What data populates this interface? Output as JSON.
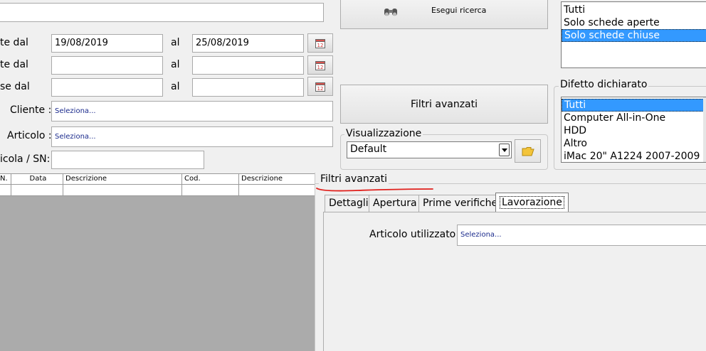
{
  "filters": {
    "top_input_value": "",
    "row1": {
      "label": "te dal",
      "from": "19/08/2019",
      "to_label": "al",
      "to": "25/08/2019"
    },
    "row2": {
      "label": "te dal",
      "from": "",
      "to_label": "al",
      "to": ""
    },
    "row3": {
      "label": "se dal",
      "from": "",
      "to_label": "al",
      "to": ""
    },
    "cliente": {
      "label": "Cliente :",
      "value": "Seleziona..."
    },
    "articolo": {
      "label": "Articolo :",
      "value": "Seleziona..."
    },
    "matricola": {
      "label": "icola / SN:",
      "value": ""
    }
  },
  "search_button": {
    "label": "Esegui ricerca"
  },
  "status_list": {
    "items": [
      {
        "label": "Tutti",
        "selected": false
      },
      {
        "label": "Solo schede aperte",
        "selected": false
      },
      {
        "label": "Solo schede chiuse",
        "selected": true
      }
    ]
  },
  "advanced_button": {
    "label": "Filtri avanzati"
  },
  "visualizzazione": {
    "title": "Visualizzazione",
    "selected": "Default"
  },
  "difetto": {
    "title": "Difetto dichiarato",
    "items": [
      {
        "label": "Tutti",
        "selected": true
      },
      {
        "label": "Computer All-in-One",
        "selected": false
      },
      {
        "label": "HDD",
        "selected": false
      },
      {
        "label": "Altro",
        "selected": false
      },
      {
        "label": "iMac 20\" A1224 2007-2009",
        "selected": false
      }
    ]
  },
  "grid": {
    "columns": [
      "N.",
      "Data",
      "Descrizione",
      "Cod.",
      "Descrizione"
    ]
  },
  "advanced_panel": {
    "title": "Filtri avanzati",
    "tabs": [
      {
        "label": "Dettagli",
        "active": false
      },
      {
        "label": "Apertura",
        "active": false
      },
      {
        "label": "Prime verifiche",
        "active": false
      },
      {
        "label": "Lavorazione",
        "active": true
      }
    ],
    "articolo_utilizzato": {
      "label": "Articolo utilizzato :",
      "value": "Seleziona..."
    }
  },
  "colors": {
    "selection": "#3399ff",
    "annotation_underline": "#e0201c",
    "grid_empty": "#ababab"
  }
}
